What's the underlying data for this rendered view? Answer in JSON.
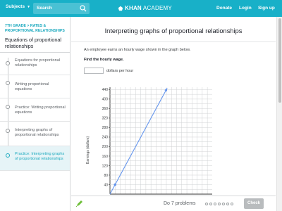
{
  "nav": {
    "subjects": "Subjects",
    "search_placeholder": "Search",
    "logo_bold": "KHAN",
    "logo_light": "ACADEMY",
    "donate": "Donate",
    "login": "Login",
    "signup": "Sign up"
  },
  "sidebar": {
    "breadcrumb": "7th grade > Rates & proportional relationships",
    "title": "Equations of proportional relationships",
    "items": [
      {
        "label": "Equations for proportional relationships",
        "active": false
      },
      {
        "label": "Writing proportional equations",
        "active": false
      },
      {
        "label": "Practice: Writing proportional equations",
        "active": false
      },
      {
        "label": "Interpreting graphs of proportional relationships",
        "active": false
      },
      {
        "label": "Practice: Interpreting graphs of proportional relationships",
        "active": true
      }
    ]
  },
  "exercise": {
    "title": "Interpreting graphs of proportional relationships",
    "prompt": "An employee earns an hourly wage shown in the graph below.",
    "question": "Find the hourly wage.",
    "answer_value": "",
    "unit": "dollars per hour"
  },
  "chart_data": {
    "type": "line",
    "ylabel": "Earnings (dollars)",
    "xlabel": "",
    "ylim": [
      0,
      450
    ],
    "yticks": [
      40,
      80,
      120,
      160,
      200,
      240,
      280,
      320,
      360,
      400,
      440
    ],
    "ytick_labels": [
      "40",
      "80",
      "120",
      "160",
      "200",
      "240",
      "280",
      "320",
      "360",
      "400",
      "440"
    ],
    "grid": true,
    "series": [
      {
        "x": [
          0,
          11
        ],
        "y": [
          0,
          440
        ],
        "color": "#6495ed"
      }
    ],
    "points": [
      {
        "x": 1,
        "y": 40
      }
    ]
  },
  "footer": {
    "progress_label": "Do 7 problems",
    "problem_count": 7,
    "check_label": "Check"
  },
  "colors": {
    "brand": "#18b0c8",
    "accent_text": "#1ba9be",
    "line": "#6495ed"
  }
}
